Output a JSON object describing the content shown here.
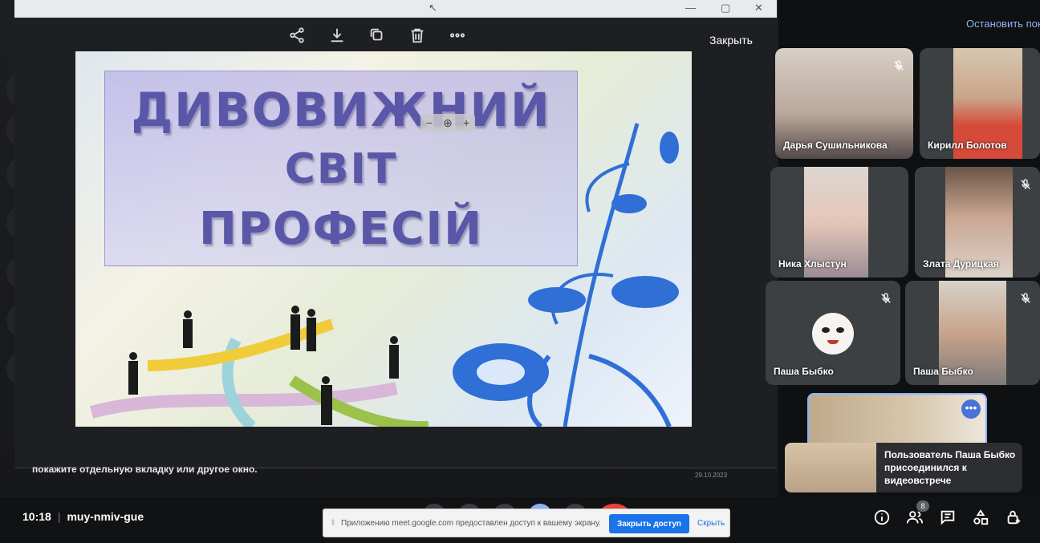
{
  "viewer": {
    "close_label": "Закрыть",
    "toolbar": [
      {
        "icon": "share-icon"
      },
      {
        "icon": "download-icon"
      },
      {
        "icon": "rotate-icon"
      },
      {
        "icon": "delete-icon"
      },
      {
        "icon": "more-icon"
      }
    ],
    "slide": {
      "line1": "ДИВОВИЖНИЙ",
      "line2": "СВІТ",
      "line3": "ПРОФЕСІЙ"
    }
  },
  "share_hint": "покажите отдельную вкладку или другое окно.",
  "share_hint_date": "29.10.2023",
  "stop_share_label": "Остановить пок",
  "participants": [
    {
      "name": "Дарья Сушильникова",
      "muted": true
    },
    {
      "name": "Кирилл Болотов",
      "muted": false
    },
    {
      "name": "Ника Хлыстун",
      "muted": false
    },
    {
      "name": "Злата Дурицкая",
      "muted": true
    },
    {
      "name": "Паша Быбко",
      "muted": true
    },
    {
      "name": "Паша Быбко",
      "muted": true
    }
  ],
  "toast": "Пользователь Паша Быбко присоединился к видеовстрече",
  "meeting": {
    "time": "10:18",
    "code": "muy-nmiv-gue"
  },
  "share_bar": {
    "text": "Приложению meet.google.com предоставлен доступ к вашему экрану.",
    "primary": "Закрыть доступ",
    "secondary": "Скрыть"
  },
  "people_count": "8",
  "colors": {
    "accent": "#1a73e8",
    "link": "#8ab4f8",
    "background": "#111214"
  }
}
